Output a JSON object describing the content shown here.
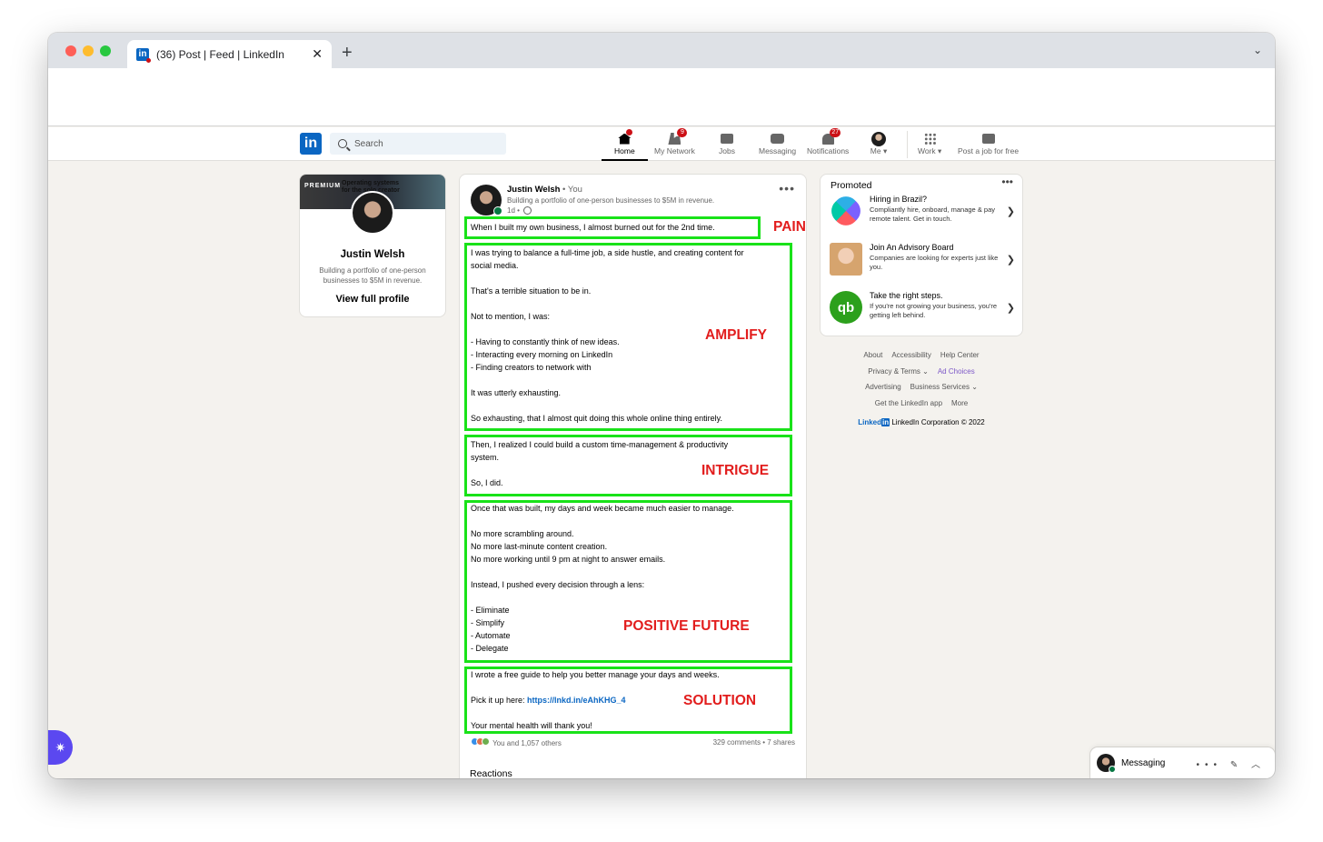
{
  "browser": {
    "tab_title": "(36) Post | Feed | LinkedIn",
    "tab_close": "✕",
    "new_tab": "+",
    "tab_menu": "⌄"
  },
  "nav": {
    "logo": "in",
    "search_placeholder": "Search",
    "items": [
      {
        "label": "Home",
        "badge": ""
      },
      {
        "label": "My Network",
        "badge": "9"
      },
      {
        "label": "Jobs",
        "badge": ""
      },
      {
        "label": "Messaging",
        "badge": ""
      },
      {
        "label": "Notifications",
        "badge": "27"
      },
      {
        "label": "Me ▾",
        "badge": ""
      },
      {
        "label": "Work ▾",
        "badge": ""
      },
      {
        "label": "Post a job for free",
        "badge": ""
      }
    ]
  },
  "profile": {
    "banner_premium": "PREMIUM",
    "banner_text": "Operating systems for the solo creator",
    "name": "Justin Welsh",
    "headline": "Building a portfolio of one-person businesses to $5M in revenue.",
    "view_link": "View full profile"
  },
  "post": {
    "author": "Justin Welsh",
    "author_suffix": " • You",
    "headline": "Building a portfolio of one-person businesses to $5M in revenue.",
    "time": "1d •",
    "more": "•••",
    "sections": {
      "pain": "When I built my own business, I almost burned out for the 2nd time.",
      "amplify": "I was trying to balance a full-time job, a side hustle, and creating content for\nsocial media.\n\nThat's a terrible situation to be in.\n\nNot to mention, I was:\n\n- Having to constantly think of new ideas.\n- Interacting every morning on LinkedIn\n- Finding creators to network with\n\nIt was utterly exhausting.\n\nSo exhausting, that I almost quit doing this whole online thing entirely.",
      "intrigue": "Then, I realized I could build a custom time-management & productivity\nsystem.\n\nSo, I did.",
      "future": "Once that was built, my days and week became much easier to manage.\n\nNo more scrambling around.\nNo more last-minute content creation.\nNo more working until 9 pm at night to answer emails.\n\nInstead, I pushed every decision through a lens:\n\n- Eliminate\n- Simplify\n- Automate\n- Delegate",
      "solution_line1": "I wrote a free guide to help you better manage your days and weeks.",
      "solution_pick": "Pick it up here: ",
      "solution_link": "https://lnkd.in/eAhKHG_4",
      "solution_line3": "Your mental health will thank you!"
    },
    "labels": {
      "pain": "PAIN",
      "amplify": "AMPLIFY",
      "intrigue": "INTRIGUE",
      "future": "POSITIVE FUTURE",
      "solution": "SOLUTION"
    },
    "reactions_text": "You and 1,057 others",
    "engagement": "329 comments • 7 shares",
    "reactions_heading": "Reactions"
  },
  "ads": {
    "title": "Promoted",
    "more": "•••",
    "items": [
      {
        "title": "Hiring in Brazil?",
        "desc": "Compliantly hire, onboard, manage & pay remote talent. Get in touch."
      },
      {
        "title": "Join An Advisory Board",
        "desc": "Companies are looking for experts just like you."
      },
      {
        "title": "Take the right steps.",
        "desc": "If you're not growing your business, you're getting left behind.",
        "logo": "qb"
      }
    ],
    "chevron": "❯"
  },
  "footer": {
    "about": "About",
    "accessibility": "Accessibility",
    "help": "Help Center",
    "privacy": "Privacy & Terms ⌄",
    "ad_choices": "Ad Choices",
    "advertising": "Advertising",
    "business": "Business Services ⌄",
    "app": "Get the LinkedIn app",
    "more": "More",
    "brand": "Linked",
    "brand_in": "in",
    "copyright": " LinkedIn Corporation © 2022"
  },
  "messaging": {
    "title": "Messaging",
    "icons": "••• ✎ ︿"
  },
  "floating": {
    "icon": "✷"
  }
}
